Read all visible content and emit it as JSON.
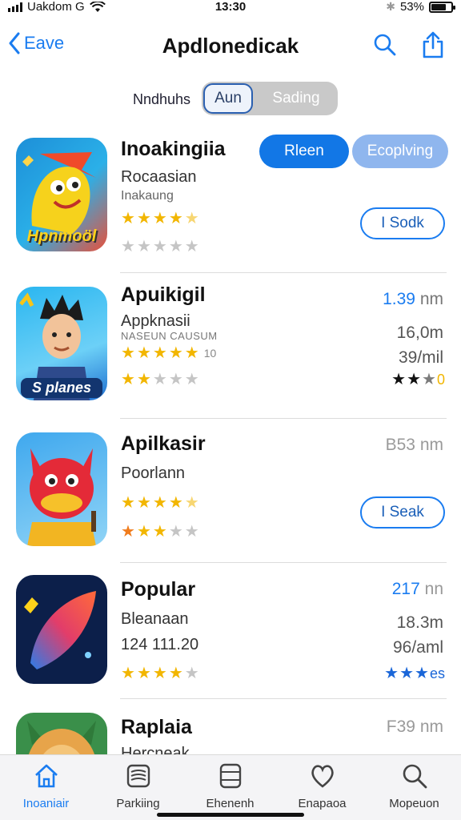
{
  "status_bar": {
    "carrier": "Uakdom G",
    "time": "13:30",
    "battery": "53%"
  },
  "nav": {
    "back_label": "Eave",
    "title": "Apdlonedicak"
  },
  "segment": {
    "label": "Nndhuhs",
    "options": [
      "Aun",
      "Sading"
    ],
    "selected": "Aun"
  },
  "apps": [
    {
      "name": "Inoakingiia",
      "subtitle": "Rocaasian",
      "subtitle2": "Inakaung",
      "rating": 4.5,
      "rating_count": "",
      "stars2": 0,
      "buttons": [
        "Rleen",
        "Ecoplving"
      ],
      "action_label": "I Sodk",
      "icon_text": "Hpnmoöl"
    },
    {
      "name": "Apuikigil",
      "subtitle": "Appknasii",
      "subtitle2": "NASEUN CAUSUM",
      "rating": 5,
      "rating_count": "10",
      "stars2": 2,
      "price": "1.39",
      "price_unit": "nm",
      "size": "16,0m",
      "size2": "39/mil",
      "right_rating": 2.5,
      "right_rating_suffix": "0",
      "icon_text": "S planes"
    },
    {
      "name": "Apilkasir",
      "subtitle": "Poorlann",
      "rating": 4.5,
      "rating_count": "",
      "stars2": 3,
      "price": "B53",
      "price_unit": "nm",
      "action_label": "I Seak"
    },
    {
      "name": "Popular",
      "subtitle": "Bleanaan",
      "subtitle2": "124 111.20",
      "rating": 4,
      "rating_count": "",
      "stars2": 0,
      "price": "217",
      "price_unit": "nn",
      "size": "18.3m",
      "size2": "96/aml",
      "right_rating": 3,
      "right_rating_suffix": "es"
    },
    {
      "name": "Raplaia",
      "subtitle": "Hercneak",
      "price": "F39",
      "price_unit": "nm"
    }
  ],
  "tabs": [
    {
      "label": "Inoaniair",
      "icon": "home-icon",
      "active": true
    },
    {
      "label": "Parkiing",
      "icon": "stack-icon",
      "active": false
    },
    {
      "label": "Ehenenh",
      "icon": "device-icon",
      "active": false
    },
    {
      "label": "Enapaoa",
      "icon": "heart-icon",
      "active": false
    },
    {
      "label": "Mopeuon",
      "icon": "search-icon",
      "active": false
    }
  ],
  "colors": {
    "accent": "#1a7cf0",
    "star": "#f2b600",
    "star_off": "#c5c5c5"
  }
}
